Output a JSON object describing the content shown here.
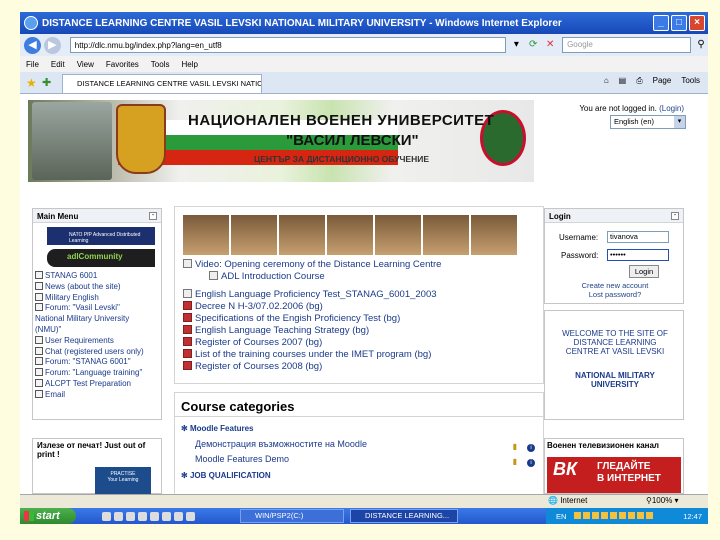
{
  "window": {
    "title": "DISTANCE LEARNING CENTRE VASIL LEVSKI NATIONAL MILITARY UNIVERSITY - Windows Internet Explorer"
  },
  "addressbar": {
    "url": "http://dlc.nmu.bg/index.php?lang=en_utf8",
    "search_placeholder": "Google"
  },
  "menubar": [
    "File",
    "Edit",
    "View",
    "Favorites",
    "Tools",
    "Help"
  ],
  "tab": {
    "label": "DISTANCE LEARNING CENTRE VASIL LEVSKI NATION...",
    "page_cmd": "Page",
    "tools_cmd": "Tools"
  },
  "banner": {
    "line1": "НАЦИОНАЛЕН ВОЕНЕН УНИВЕРСИТЕТ",
    "line2": "\"ВАСИЛ ЛЕВСКИ\"",
    "line3": "ЦЕНТЪР ЗА ДИСТАНЦИОННО ОБУЧЕНИЕ",
    "flag_colors": [
      "#ffffff",
      "#2a9a3a",
      "#d62612"
    ]
  },
  "userinfo": {
    "text": "You are not logged in.",
    "login_link": "(Login)",
    "language": "English (en)"
  },
  "mainmenu": {
    "title": "Main Menu",
    "logo1_text": "NATO PfP Advanced Distributed Learning",
    "logo2_text": "adlCommunity",
    "items": [
      "STANAG 6001",
      "News (about the site)",
      "Military English",
      "Forum: \"Vasil Levski\"",
      "National Military University",
      "(NMU)\"",
      "User Requirements",
      "Chat (registered users only)",
      "Forum: \"STANAG 6001\"",
      "Forum: \"Language training\"",
      "ALCPT Test Preparation",
      "Email"
    ]
  },
  "center": {
    "video_link": "Video: Opening ceremony of the Distance Learning Centre",
    "intro_link": "ADL Introduction Course",
    "docs": [
      "English Language Proficiency Test_STANAG_6001_2003",
      "Decree N H-3/07.02.2006 (bg)",
      "Specifications of the Engish Proficiency Test (bg)",
      "English Language Teaching Strategy (bg)",
      "Register of Courses 2007 (bg)",
      "List of the training courses under the IMET program (bg)",
      "Register of Courses 2008 (bg)"
    ]
  },
  "categories": {
    "title": "Course categories",
    "cat1": "Moodle Features",
    "course1": "Демонстрация възможностите на Moodle",
    "course2": "Moodle Features Demo",
    "cat2": "JOB QUALIFICATION"
  },
  "login": {
    "title": "Login",
    "username_label": "Username:",
    "username_value": "tivanova",
    "password_label": "Password:",
    "password_value": "••••••",
    "button": "Login",
    "create_link": "Create new account",
    "lost_link": "Lost password?"
  },
  "welcome": {
    "line1": "WELCOME TO THE SITE OF",
    "line2": "DISTANCE LEARNING",
    "line3": "CENTRE AT VASIL LEVSKI",
    "line4": "NATIONAL MILITARY",
    "line5": "UNIVERSITY"
  },
  "ad": {
    "title": "Излезе от печат! Just out of print !",
    "img_text1": "PRACTISE",
    "img_text2": "Your Learning"
  },
  "tv": {
    "title": "Военен телевизионен канал",
    "logo": "ВК",
    "img_line1": "ГЛЕДАЙТЕ",
    "img_line2": "В ИНТЕРНЕТ"
  },
  "statusbar": {
    "zone": "Internet",
    "zoom": "100%"
  },
  "taskbar": {
    "start": "start",
    "task1": "WIN/PSP2(C:)",
    "task2": "DISTANCE LEARNING...",
    "lang": "EN",
    "clock": "12:47"
  }
}
